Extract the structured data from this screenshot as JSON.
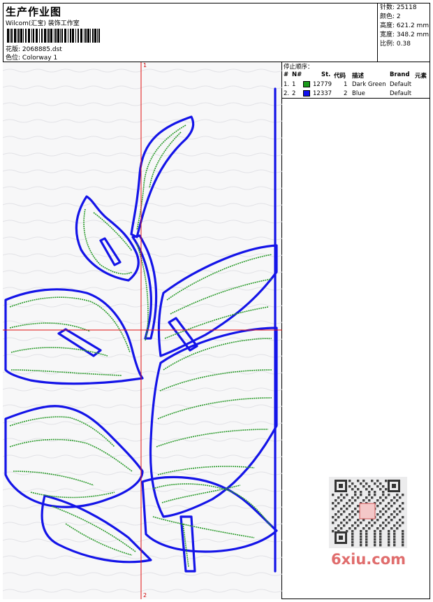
{
  "header": {
    "title": "生产作业图",
    "company": "Wilcom(汇宝) 装饰工作室",
    "design_file_label": "花版:",
    "design_file": "2068885.dst",
    "colorway_label": "色位:",
    "colorway": "Colorway 1"
  },
  "stats": [
    {
      "label": "针数",
      "value": "25118"
    },
    {
      "label": "颜色",
      "value": "2"
    },
    {
      "label": "高度",
      "value": "621.2 mm"
    },
    {
      "label": "宽度",
      "value": "348.2 mm"
    },
    {
      "label": "比例",
      "value": "0.38"
    }
  ],
  "thread_panel": {
    "title": "停止顺序：",
    "columns": [
      "#",
      "N#",
      "St.",
      "代码",
      "描述",
      "Brand",
      "元素"
    ],
    "rows": [
      {
        "num": "1.",
        "n": "1",
        "color": "#1a9a1a",
        "stitches": "12779",
        "code": "1",
        "desc": "Dark Green",
        "brand": "Default"
      },
      {
        "num": "2.",
        "n": "2",
        "color": "#1010ee",
        "stitches": "12337",
        "code": "2",
        "desc": "Blue",
        "brand": "Default"
      }
    ]
  },
  "axis_labels": {
    "top": "1",
    "bottom": "2"
  },
  "watermark": "6xiu.com",
  "colors": {
    "green": "#2a9a2a",
    "blue": "#1414e8",
    "crosshair": "#e01010"
  }
}
